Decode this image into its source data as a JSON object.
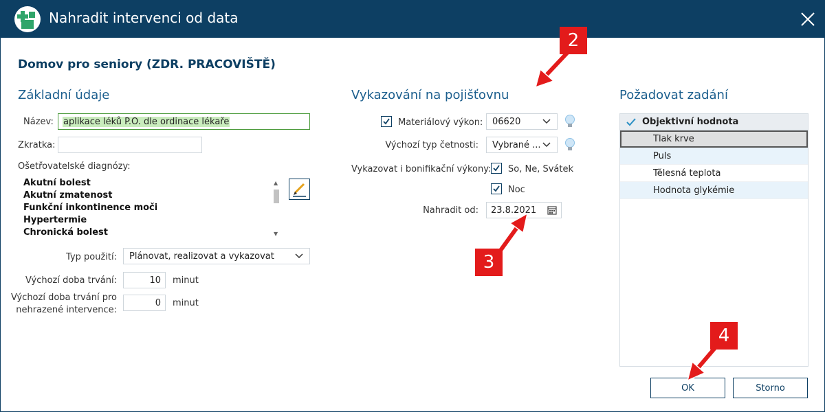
{
  "window": {
    "title": "Nahradit intervenci od data"
  },
  "heading": "Domov pro seniory (ZDR. PRACOVIŠTĚ)",
  "basic": {
    "title": "Základní údaje",
    "name_label": "Název:",
    "name_value": "aplikace léků P.O. dle ordinace lékaře",
    "abbr_label": "Zkratka:",
    "abbr_value": "",
    "diag_label": "Ošetřovatelské diagnózy:",
    "diagnoses": [
      "Akutní bolest",
      "Akutní zmatenost",
      "Funkční inkontinence moči",
      "Hypertermie",
      "Chronická bolest"
    ],
    "usage_label": "Typ použití:",
    "usage_value": "Plánovat, realizovat a vykazovat",
    "duration_label": "Výchozí doba trvání:",
    "duration_value": "10",
    "duration_unit": "minut",
    "duration2_label_1": "Výchozí doba trvání pro",
    "duration2_label_2": "nehrazené intervence:",
    "duration2_value": "0",
    "duration2_unit": "minut"
  },
  "insurance": {
    "title": "Vykazování na pojišťovnu",
    "material_label": "Materiálový výkon:",
    "material_checked": true,
    "material_value": "06620",
    "freq_label": "Výchozí typ četnosti:",
    "freq_value": "Vybrané ...",
    "bonus_label": "Vykazovat i bonifikační výkony:",
    "bonus_opt1": "So, Ne, Svátek",
    "bonus_opt2": "Noc",
    "replace_label": "Nahradit od:",
    "replace_value": "23.8.2021"
  },
  "required": {
    "title": "Požadovat zadání",
    "header": "Objektivní hodnota",
    "rows": [
      "Tlak krve",
      "Puls",
      "Tělesná teplota",
      "Hodnota glykémie"
    ]
  },
  "buttons": {
    "ok": "OK",
    "cancel": "Storno"
  },
  "callouts": {
    "c2": "2",
    "c3": "3",
    "c4": "4"
  },
  "colors": {
    "titlebar": "#0d3f63",
    "accent": "#1c5f8e",
    "callout": "#e31b1b"
  }
}
